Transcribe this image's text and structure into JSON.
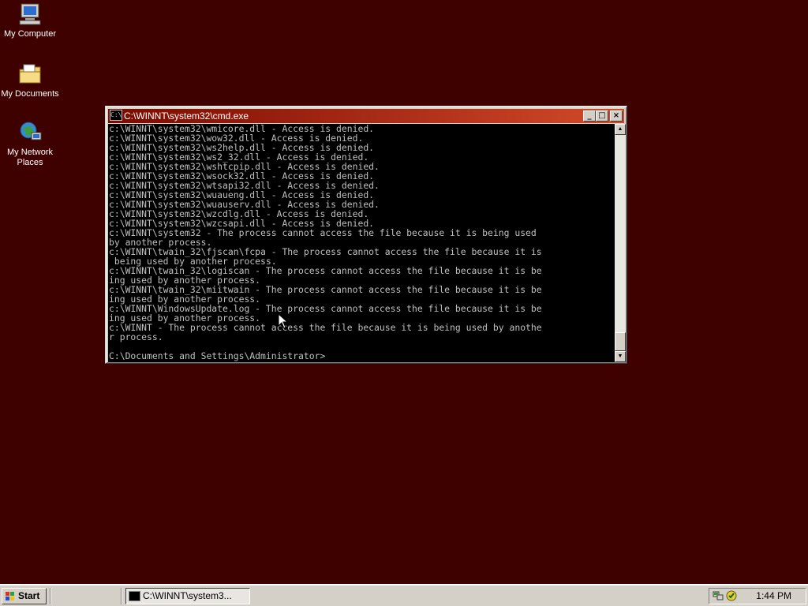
{
  "desktop": {
    "background_color": "#3f0000",
    "icons": [
      {
        "label": "My Computer",
        "icon": "computer-icon"
      },
      {
        "label": "My Documents",
        "icon": "folder-icon"
      },
      {
        "label": "My Network Places",
        "icon": "network-icon"
      }
    ]
  },
  "window": {
    "title": "C:\\WINNT\\system32\\cmd.exe",
    "icon": "console-icon",
    "titlebar_color": "#8b0f00",
    "console_lines": [
      "c:\\WINNT\\system32\\wmicore.dll - Access is denied.",
      "c:\\WINNT\\system32\\wow32.dll - Access is denied.",
      "c:\\WINNT\\system32\\ws2help.dll - Access is denied.",
      "c:\\WINNT\\system32\\ws2_32.dll - Access is denied.",
      "c:\\WINNT\\system32\\wshtcpip.dll - Access is denied.",
      "c:\\WINNT\\system32\\wsock32.dll - Access is denied.",
      "c:\\WINNT\\system32\\wtsapi32.dll - Access is denied.",
      "c:\\WINNT\\system32\\wuaueng.dll - Access is denied.",
      "c:\\WINNT\\system32\\wuauserv.dll - Access is denied.",
      "c:\\WINNT\\system32\\wzcdlg.dll - Access is denied.",
      "c:\\WINNT\\system32\\wzcsapi.dll - Access is denied.",
      "c:\\WINNT\\system32 - The process cannot access the file because it is being used",
      "by another process.",
      "c:\\WINNT\\twain_32\\fjscan\\fcpa - The process cannot access the file because it is",
      " being used by another process.",
      "c:\\WINNT\\twain_32\\logiscan - The process cannot access the file because it is be",
      "ing used by another process.",
      "c:\\WINNT\\twain_32\\miitwain - The process cannot access the file because it is be",
      "ing used by another process.",
      "c:\\WINNT\\WindowsUpdate.log - The process cannot access the file because it is be",
      "ing used by another process.",
      "c:\\WINNT - The process cannot access the file because it is being used by anothe",
      "r process.",
      "",
      "C:\\Documents and Settings\\Administrator>"
    ]
  },
  "taskbar": {
    "start_label": "Start",
    "task_label": "C:\\WINNT\\system3...",
    "clock": "1:44 PM"
  }
}
